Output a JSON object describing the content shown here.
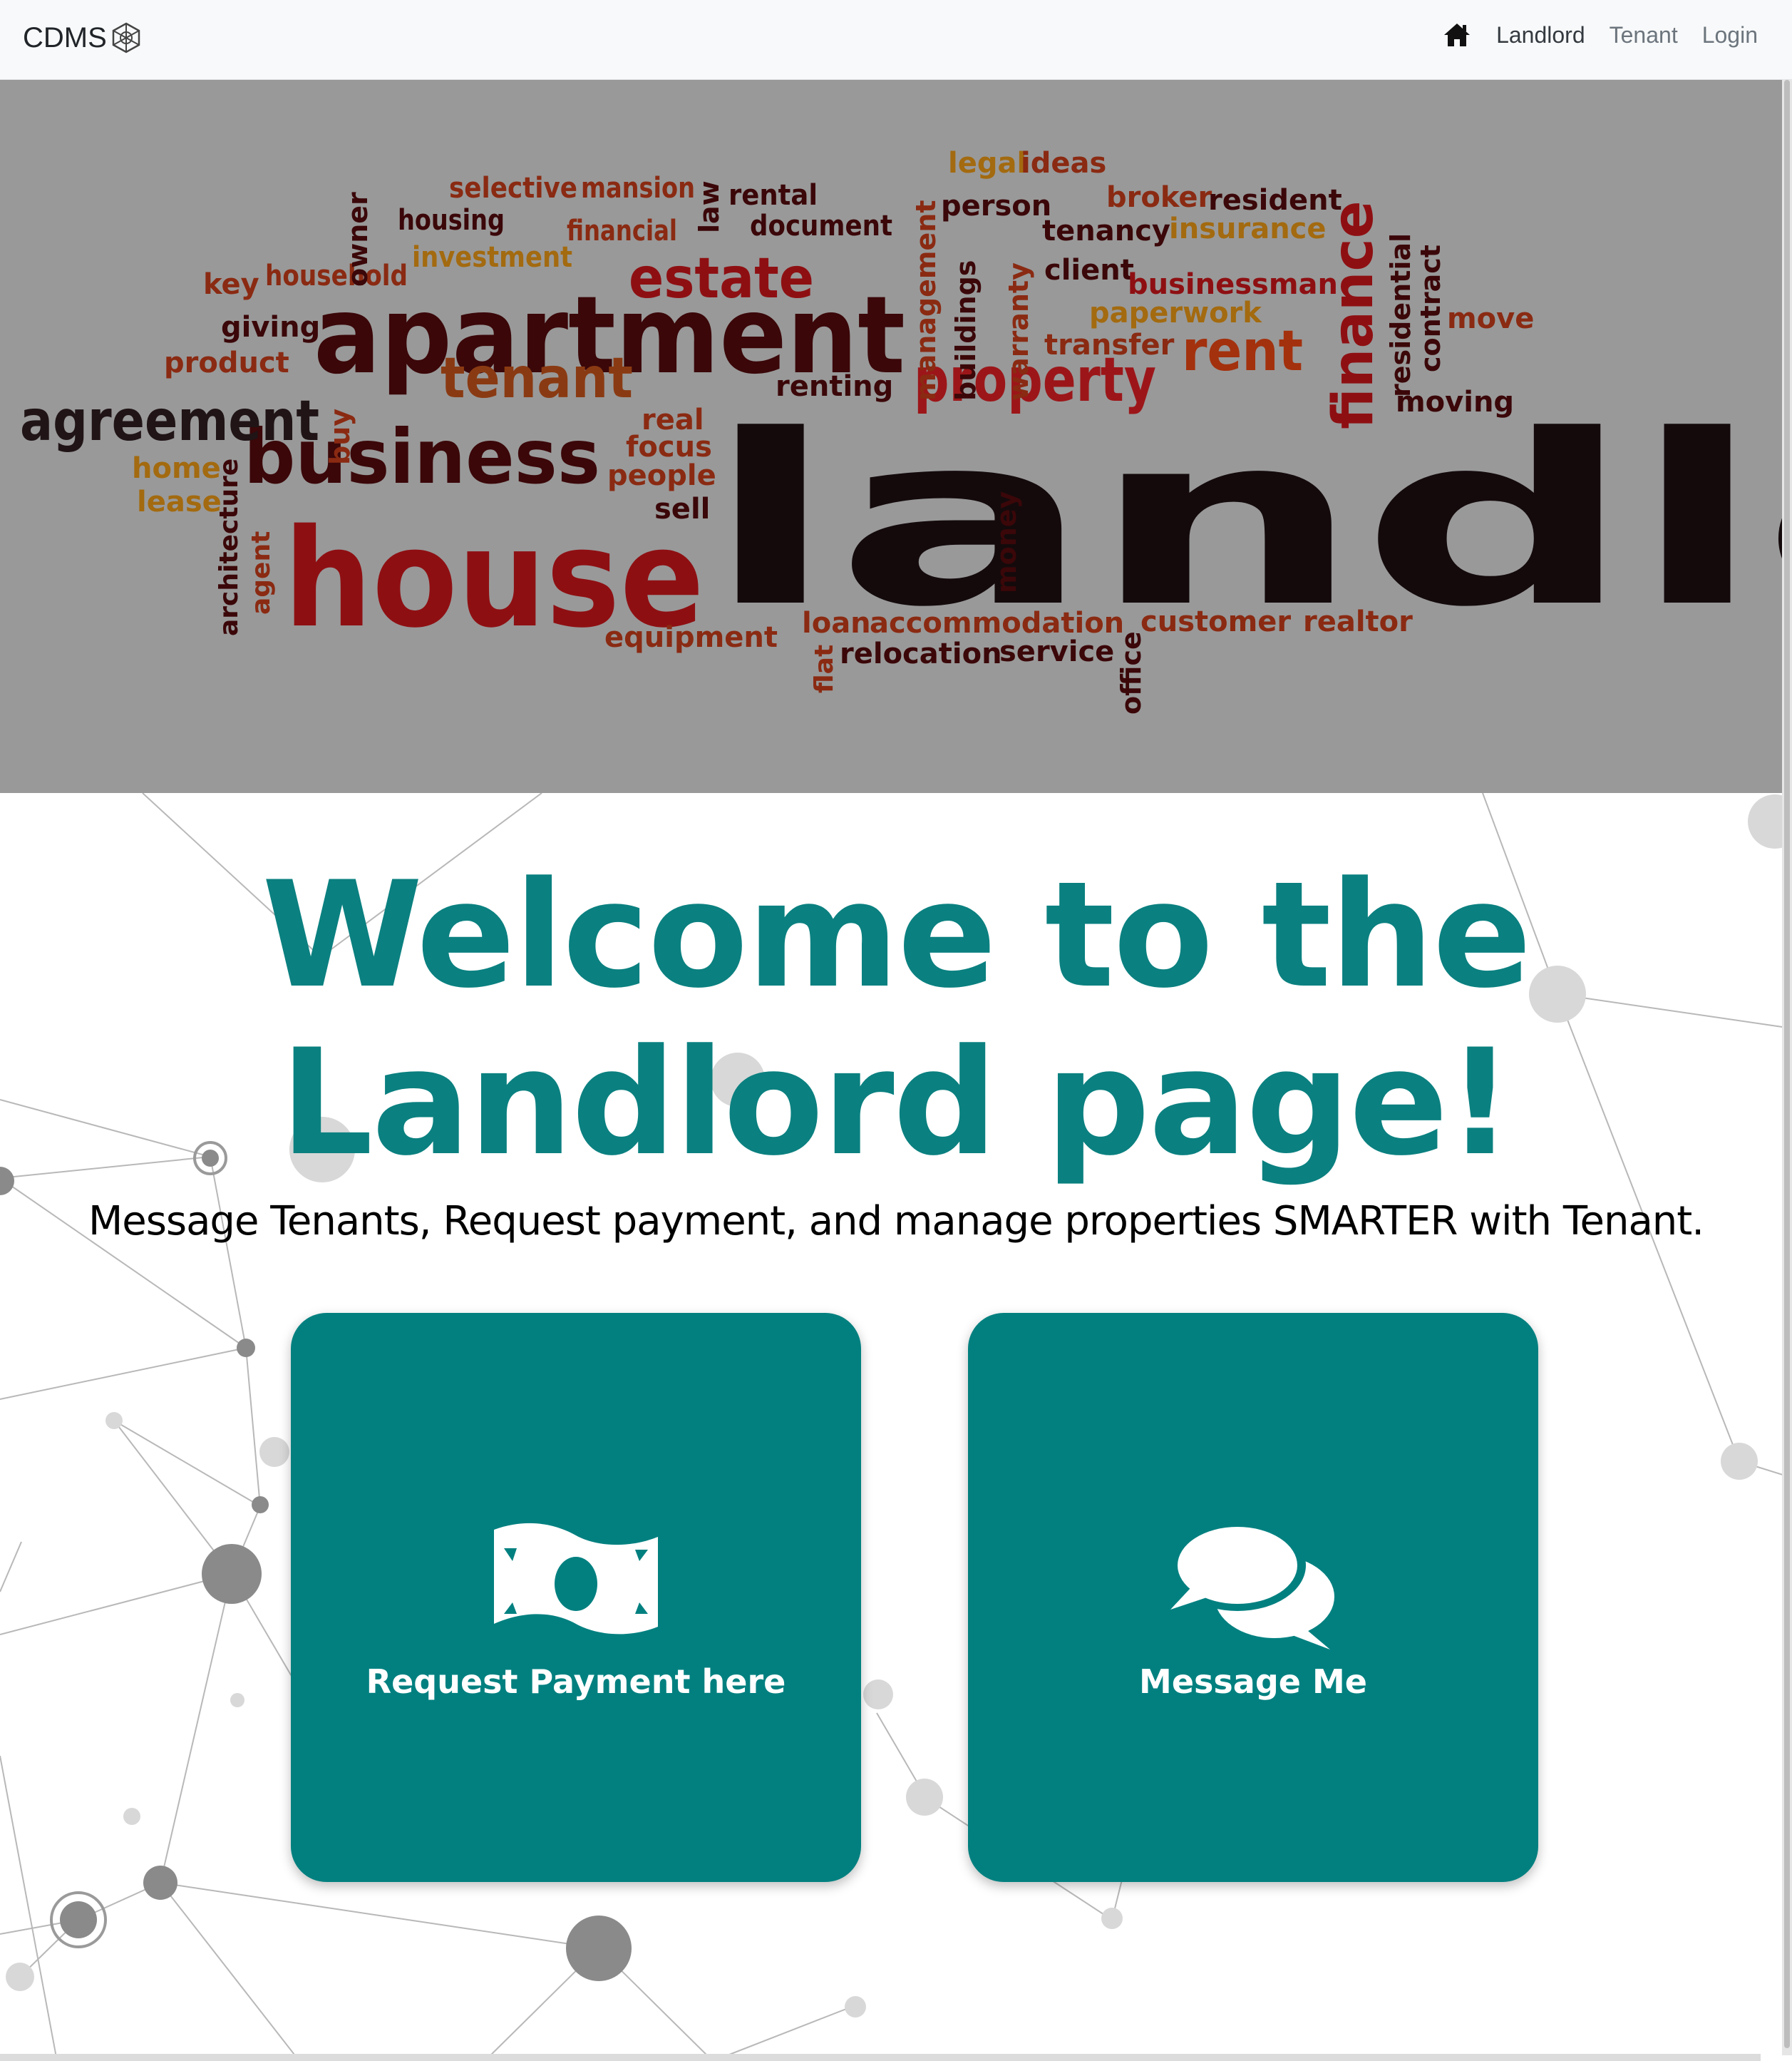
{
  "navbar": {
    "brand": "CDMS",
    "links": [
      "Landlord",
      "Tenant",
      "Login"
    ]
  },
  "hero": {
    "words": [
      {
        "t": "landlord",
        "c": "#140a0c"
      },
      {
        "t": "house",
        "c": "#8e0f12"
      },
      {
        "t": "apartment",
        "c": "#3b0709"
      },
      {
        "t": "business",
        "c": "#3b0709"
      },
      {
        "t": "agreement",
        "c": "#201416"
      },
      {
        "t": "property",
        "c": "#9c1619"
      },
      {
        "t": "estate",
        "c": "#8e0f12"
      },
      {
        "t": "tenant",
        "c": "#8a3a12"
      },
      {
        "t": "rent",
        "c": "#a3310d"
      },
      {
        "t": "finance",
        "c": "#8e0f12"
      },
      {
        "t": "selective",
        "c": "#8a2a12"
      },
      {
        "t": "mansion",
        "c": "#8a2a12"
      },
      {
        "t": "rental",
        "c": "#3b0709"
      },
      {
        "t": "document",
        "c": "#3b0709"
      },
      {
        "t": "housing",
        "c": "#3b0709"
      },
      {
        "t": "financial",
        "c": "#8a2a12"
      },
      {
        "t": "investment",
        "c": "#a36a0f"
      },
      {
        "t": "household",
        "c": "#8a2a12"
      },
      {
        "t": "key",
        "c": "#8a2a12"
      },
      {
        "t": "giving",
        "c": "#3b0709"
      },
      {
        "t": "product",
        "c": "#8a2a12"
      },
      {
        "t": "owner",
        "c": "#3b0709"
      },
      {
        "t": "law",
        "c": "#3b0709"
      },
      {
        "t": "legal",
        "c": "#a36a0f"
      },
      {
        "t": "ideas",
        "c": "#8a2a12"
      },
      {
        "t": "person",
        "c": "#3b0709"
      },
      {
        "t": "broker",
        "c": "#8a2a12"
      },
      {
        "t": "resident",
        "c": "#3b0709"
      },
      {
        "t": "tenancy",
        "c": "#3b0709"
      },
      {
        "t": "insurance",
        "c": "#a36a0f"
      },
      {
        "t": "client",
        "c": "#3b0709"
      },
      {
        "t": "businessman",
        "c": "#8e0f12"
      },
      {
        "t": "paperwork",
        "c": "#a36a0f"
      },
      {
        "t": "transfer",
        "c": "#8a2a12"
      },
      {
        "t": "management",
        "c": "#8a2a12"
      },
      {
        "t": "buildings",
        "c": "#3b0709"
      },
      {
        "t": "warranty",
        "c": "#8a2a12"
      },
      {
        "t": "residential",
        "c": "#3b0709"
      },
      {
        "t": "contract",
        "c": "#3b0709"
      },
      {
        "t": "move",
        "c": "#8a2a12"
      },
      {
        "t": "moving",
        "c": "#3b0709"
      },
      {
        "t": "renting",
        "c": "#3b0709"
      },
      {
        "t": "real",
        "c": "#8a2a12"
      },
      {
        "t": "focus",
        "c": "#8a2a12"
      },
      {
        "t": "people",
        "c": "#8a2a12"
      },
      {
        "t": "sell",
        "c": "#3b0709"
      },
      {
        "t": "buy",
        "c": "#8a2a12"
      },
      {
        "t": "home",
        "c": "#a36a0f"
      },
      {
        "t": "lease",
        "c": "#a36a0f"
      },
      {
        "t": "architecture",
        "c": "#3b0709"
      },
      {
        "t": "agent",
        "c": "#8a2a12"
      },
      {
        "t": "equipment",
        "c": "#8a2a12"
      },
      {
        "t": "money",
        "c": "#3b0709"
      },
      {
        "t": "loan",
        "c": "#8a2a12"
      },
      {
        "t": "accommodation",
        "c": "#8a2a12"
      },
      {
        "t": "relocation",
        "c": "#3b0709"
      },
      {
        "t": "service",
        "c": "#3b0709"
      },
      {
        "t": "flat",
        "c": "#8a2a12"
      },
      {
        "t": "office",
        "c": "#3b0709"
      },
      {
        "t": "customer",
        "c": "#8a2a12"
      },
      {
        "t": "realtor",
        "c": "#8a2a12"
      }
    ]
  },
  "main": {
    "title_line1": "Welcome to the",
    "title_line2": "Landlord page!",
    "subtitle": "Message Tenants, Request payment, and manage properties SMARTER with Tenant.",
    "cards": [
      {
        "label": "Request Payment here",
        "icon": "money-bill-icon"
      },
      {
        "label": "Message Me",
        "icon": "comments-icon"
      }
    ]
  },
  "colors": {
    "accent": "#028080",
    "title": "#0b8080",
    "hero_bg": "#999999",
    "navbar_bg": "#f8f9fa"
  }
}
